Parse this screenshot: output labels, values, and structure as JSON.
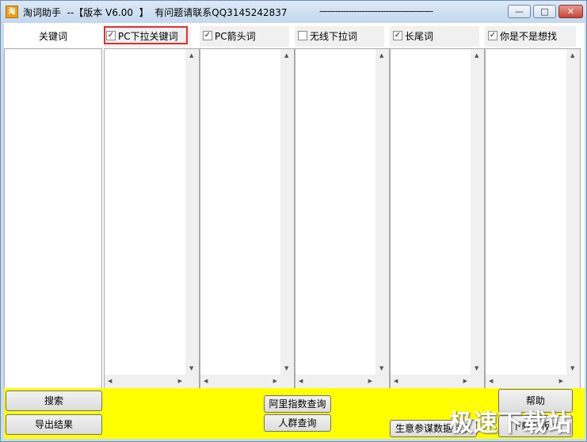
{
  "window": {
    "title": "淘词助手  --【版本 V6.00  】  有问题请联系QQ3145242837",
    "title_dashes": "-------------------------------------------",
    "icon_label": "淘",
    "controls": {
      "minimize": "—",
      "maximize": "□",
      "close": "✕"
    }
  },
  "columns": {
    "keyword_header": "关键词",
    "options": [
      {
        "label": "PC下拉关键词",
        "checked": true
      },
      {
        "label": "PC箭头词",
        "checked": true
      },
      {
        "label": "无线下拉词",
        "checked": false
      },
      {
        "label": "长尾词",
        "checked": true
      },
      {
        "label": "你是不是想找",
        "checked": true
      }
    ]
  },
  "buttons": {
    "search": "搜索",
    "export": "导出结果",
    "ali_index": "阿里指数查询",
    "crowd": "人群查询",
    "help": "帮助",
    "business": "生意参谋数据共享",
    "download": "下载新版本"
  },
  "watermark": "极速下载站",
  "colors": {
    "footer_bg": "#ffff00",
    "highlight_border": "#e03030"
  }
}
